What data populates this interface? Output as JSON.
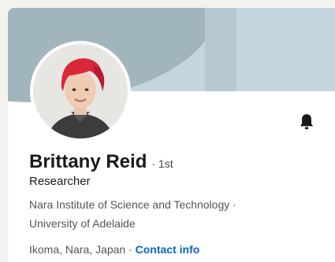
{
  "profile": {
    "name": "Brittany Reid",
    "degree": "· 1st",
    "headline": "Researcher",
    "education_1": "Nara Institute of Science and Technology ·",
    "education_2": "University of Adelaide",
    "location": "Ikoma, Nara, Japan ·",
    "contact_link": "Contact info"
  },
  "icons": {
    "notify": "bell-icon"
  },
  "colors": {
    "link": "#0a66c2",
    "banner": "#c5d5dc",
    "banner_dark": "#a1b5bd"
  }
}
